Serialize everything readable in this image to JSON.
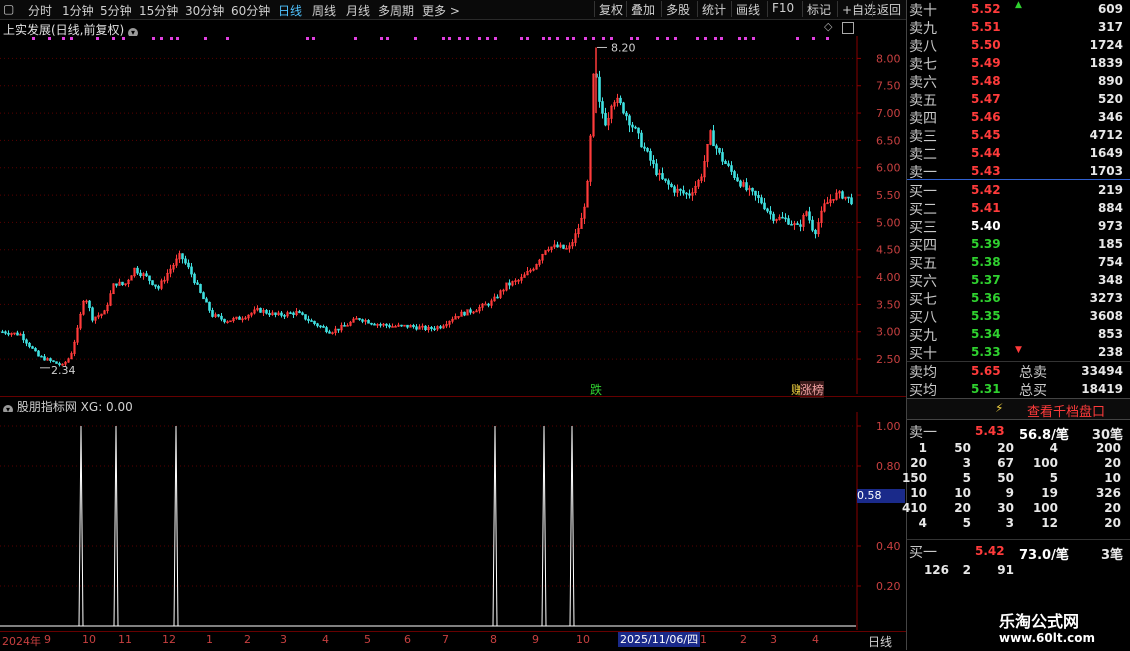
{
  "toolbar": {
    "periods": [
      "分时",
      "1分钟",
      "5分钟",
      "15分钟",
      "30分钟",
      "60分钟",
      "日线",
      "周线",
      "月线",
      "多周期",
      "更多 >"
    ],
    "active_period": "日线",
    "buttons": [
      "复权",
      "叠加",
      "多股",
      "统计",
      "画线",
      "F10",
      "标记",
      "+自选",
      "返回"
    ]
  },
  "main_chart": {
    "title": "上实发展(日线,前复权)",
    "high_label": "8.20",
    "low_label": "2.34",
    "markers": [
      "跌",
      "赚",
      "涨榜"
    ],
    "price_ticks": [
      "8.00",
      "7.50",
      "7.00",
      "6.50",
      "6.00",
      "5.50",
      "5.00",
      "4.50",
      "4.00",
      "3.50",
      "3.00",
      "2.50"
    ]
  },
  "indicator": {
    "title": "股朋指标网",
    "xg_label": "XG: 0.00",
    "ticks": [
      "1.00",
      "0.80",
      "0.40",
      "0.20"
    ],
    "current_value": "0.58"
  },
  "bottom_axis": {
    "year_label": "2024年",
    "ticks": [
      "9",
      "10",
      "11",
      "12",
      "1",
      "2",
      "3",
      "4",
      "5",
      "6",
      "7",
      "8",
      "9",
      "10",
      "1",
      "1",
      "2",
      "3",
      "4"
    ],
    "selected_date": "2025/11/06/四",
    "period_label": "日线"
  },
  "order_book": {
    "asks": [
      {
        "label": "卖十",
        "price": "5.52",
        "vol": "609"
      },
      {
        "label": "卖九",
        "price": "5.51",
        "vol": "317"
      },
      {
        "label": "卖八",
        "price": "5.50",
        "vol": "1724"
      },
      {
        "label": "卖七",
        "price": "5.49",
        "vol": "1839"
      },
      {
        "label": "卖六",
        "price": "5.48",
        "vol": "890"
      },
      {
        "label": "卖五",
        "price": "5.47",
        "vol": "520"
      },
      {
        "label": "卖四",
        "price": "5.46",
        "vol": "346"
      },
      {
        "label": "卖三",
        "price": "5.45",
        "vol": "4712"
      },
      {
        "label": "卖二",
        "price": "5.44",
        "vol": "1649"
      },
      {
        "label": "卖一",
        "price": "5.43",
        "vol": "1703"
      }
    ],
    "bids": [
      {
        "label": "买一",
        "price": "5.42",
        "vol": "219"
      },
      {
        "label": "买二",
        "price": "5.41",
        "vol": "884"
      },
      {
        "label": "买三",
        "price": "5.40",
        "vol": "973"
      },
      {
        "label": "买四",
        "price": "5.39",
        "vol": "185"
      },
      {
        "label": "买五",
        "price": "5.38",
        "vol": "754"
      },
      {
        "label": "买六",
        "price": "5.37",
        "vol": "348"
      },
      {
        "label": "买七",
        "price": "5.36",
        "vol": "3273"
      },
      {
        "label": "买八",
        "price": "5.35",
        "vol": "3608"
      },
      {
        "label": "买九",
        "price": "5.34",
        "vol": "853"
      },
      {
        "label": "买十",
        "price": "5.33",
        "vol": "238"
      }
    ],
    "sell_avg": {
      "label": "卖均",
      "price": "5.65",
      "total_label": "总卖",
      "total": "33494"
    },
    "buy_avg": {
      "label": "买均",
      "price": "5.31",
      "total_label": "总买",
      "total": "18419"
    },
    "view_button": "查看千档盘口",
    "sell1_detail": {
      "label": "卖一",
      "price": "5.43",
      "avg": "56.8/笔",
      "count": "30笔"
    },
    "sell1_grid": [
      [
        "1",
        "50",
        "20",
        "4",
        "200"
      ],
      [
        "20",
        "3",
        "67",
        "100",
        "20"
      ],
      [
        "150",
        "5",
        "50",
        "5",
        "10"
      ],
      [
        "10",
        "10",
        "9",
        "19",
        "326"
      ],
      [
        "410",
        "20",
        "30",
        "100",
        "20"
      ],
      [
        "4",
        "5",
        "3",
        "12",
        "20"
      ]
    ],
    "buy1_detail": {
      "label": "买一",
      "price": "5.42",
      "avg": "73.0/笔",
      "count": "3笔"
    },
    "buy1_grid": [
      [
        "126",
        "2",
        "91"
      ]
    ]
  },
  "watermark": {
    "title": "乐淘公式网",
    "url": "www.60lt.com"
  },
  "chart_data": {
    "type": "candlestick",
    "y_range": [
      2.3,
      8.3
    ],
    "indicator_range": [
      0,
      1.05
    ],
    "high": 8.2,
    "low": 2.34,
    "indicator_spikes": [
      1,
      1,
      1,
      1,
      1,
      1
    ]
  }
}
